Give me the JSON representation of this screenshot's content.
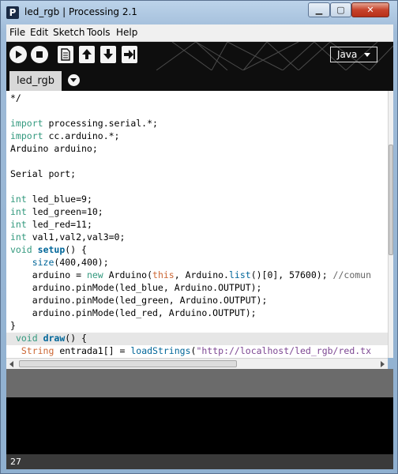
{
  "window": {
    "title": "led_rgb | Processing 2.1",
    "app_icon": "P",
    "minimize": "▁",
    "maximize": "▢",
    "close": "✕"
  },
  "menu": [
    "File",
    "Edit",
    "Sketch",
    "Tools",
    "Help"
  ],
  "toolbar": {
    "mode": "Java"
  },
  "tabs": [
    {
      "label": "led_rgb"
    }
  ],
  "code": [
    [
      {
        "t": "*/"
      }
    ],
    [],
    [
      {
        "c": "k",
        "t": "import"
      },
      {
        "t": " processing.serial.*;"
      }
    ],
    [
      {
        "c": "k",
        "t": "import"
      },
      {
        "t": " cc.arduino.*;"
      }
    ],
    [
      {
        "t": "Arduino arduino;"
      }
    ],
    [],
    [
      {
        "t": "Serial port;"
      }
    ],
    [],
    [
      {
        "c": "k",
        "t": "int"
      },
      {
        "t": " led_blue=9;"
      }
    ],
    [
      {
        "c": "k",
        "t": "int"
      },
      {
        "t": " led_green=10;"
      }
    ],
    [
      {
        "c": "k",
        "t": "int"
      },
      {
        "t": " led_red=11;"
      }
    ],
    [
      {
        "c": "k",
        "t": "int"
      },
      {
        "t": " val1,val2,val3=0;"
      }
    ],
    [
      {
        "c": "k",
        "t": "void"
      },
      {
        "t": " "
      },
      {
        "c": "fb",
        "t": "setup"
      },
      {
        "t": "() {"
      }
    ],
    [
      {
        "t": "    "
      },
      {
        "c": "f",
        "t": "size"
      },
      {
        "t": "(400,400);"
      }
    ],
    [
      {
        "t": "    arduino = "
      },
      {
        "c": "k",
        "t": "new"
      },
      {
        "t": " Arduino("
      },
      {
        "c": "kw",
        "t": "this"
      },
      {
        "t": ", Arduino."
      },
      {
        "c": "f",
        "t": "list"
      },
      {
        "t": "()[0], 57600); "
      },
      {
        "c": "c",
        "t": "//comun"
      }
    ],
    [
      {
        "t": "    arduino.pinMode(led_blue, Arduino.OUTPUT);"
      }
    ],
    [
      {
        "t": "    arduino.pinMode(led_green, Arduino.OUTPUT);"
      }
    ],
    [
      {
        "t": "    arduino.pinMode(led_red, Arduino.OUTPUT);"
      }
    ],
    [
      {
        "t": "}"
      }
    ],
    [
      {
        "t": " "
      },
      {
        "c": "k",
        "t": "void"
      },
      {
        "t": " "
      },
      {
        "c": "fb",
        "t": "draw"
      },
      {
        "t": "() {"
      }
    ],
    [
      {
        "t": "  "
      },
      {
        "c": "kw",
        "t": "String"
      },
      {
        "t": " entrada1[] = "
      },
      {
        "c": "f",
        "t": "loadStrings"
      },
      {
        "t": "("
      },
      {
        "c": "s",
        "t": "\"http://localhost/led_rgb/red.tx"
      }
    ]
  ],
  "status": {
    "line_number": "27"
  }
}
